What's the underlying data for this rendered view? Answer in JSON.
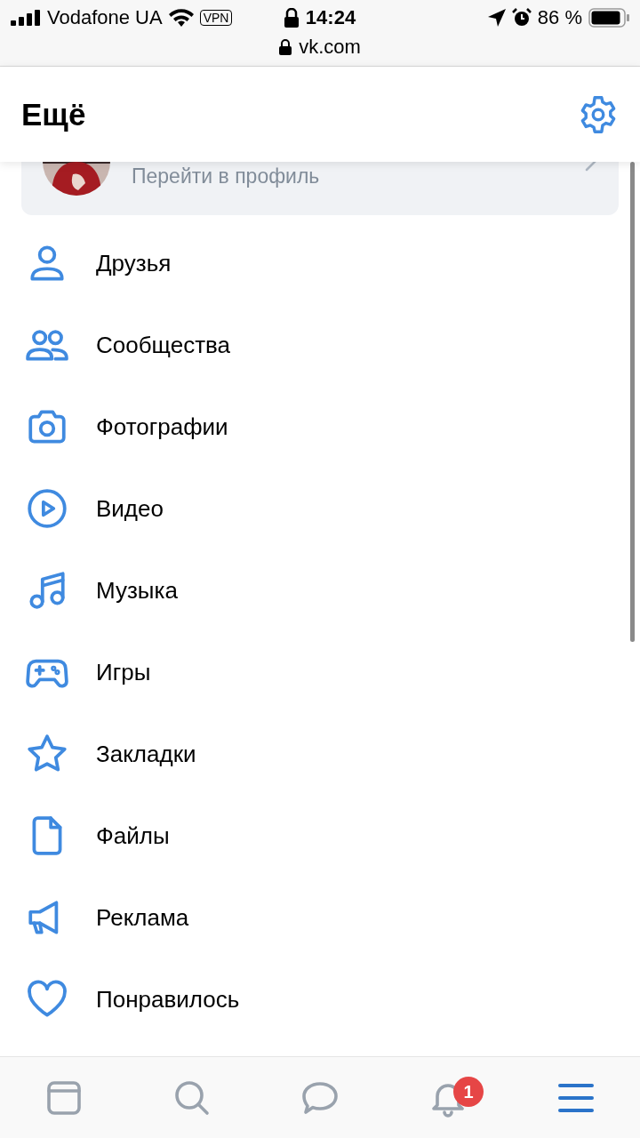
{
  "status_bar": {
    "carrier": "Vodafone UA",
    "vpn": "VPN",
    "time": "14:24",
    "battery": "86 %",
    "url": "vk.com"
  },
  "header": {
    "title": "Ещё"
  },
  "profile": {
    "subtitle": "Перейти в профиль"
  },
  "menu": [
    {
      "kind": "friends",
      "label": "Друзья"
    },
    {
      "kind": "communities",
      "label": "Сообщества"
    },
    {
      "kind": "photos",
      "label": "Фотографии"
    },
    {
      "kind": "video",
      "label": "Видео"
    },
    {
      "kind": "music",
      "label": "Музыка"
    },
    {
      "kind": "games",
      "label": "Игры"
    },
    {
      "kind": "bookmarks",
      "label": "Закладки"
    },
    {
      "kind": "files",
      "label": "Файлы"
    },
    {
      "kind": "ads",
      "label": "Реклама"
    },
    {
      "kind": "liked",
      "label": "Понравилось"
    }
  ],
  "tab_bar": [
    {
      "kind": "feed",
      "selected": false
    },
    {
      "kind": "search",
      "selected": false
    },
    {
      "kind": "messages",
      "selected": false
    },
    {
      "kind": "notifications",
      "selected": false,
      "badge": "1"
    },
    {
      "kind": "menu",
      "selected": true
    }
  ]
}
